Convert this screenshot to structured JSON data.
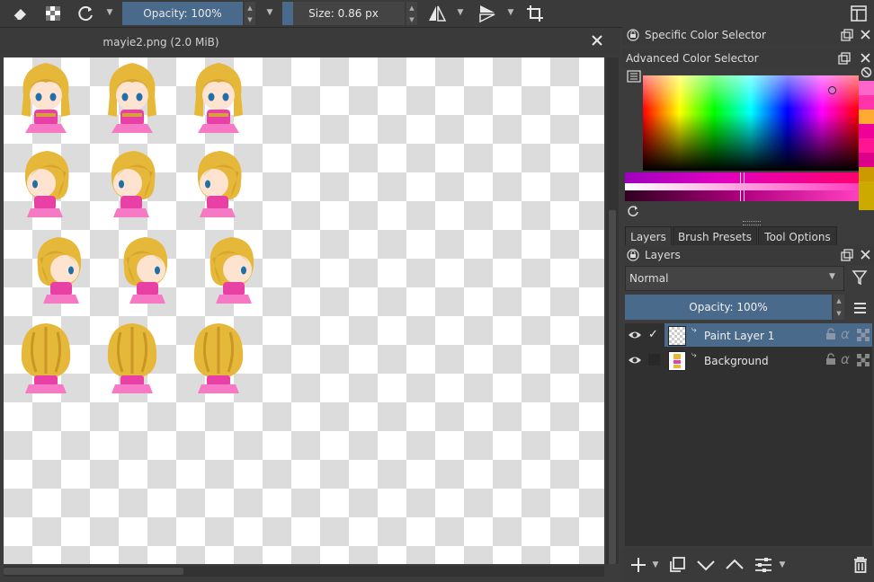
{
  "toolbar": {
    "opacity_label": "Opacity: 100%",
    "size_label": "Size: 0.86 px"
  },
  "document": {
    "title": "mayie2.png (2.0 MiB)"
  },
  "dockers": {
    "specific_color_selector": "Specific Color Selector",
    "advanced_color_selector": "Advanced Color Selector",
    "layers_title": "Layers"
  },
  "tabs": [
    {
      "label": "Layers",
      "active": true
    },
    {
      "label": "Brush Presets",
      "active": false
    },
    {
      "label": "Tool Options",
      "active": false
    }
  ],
  "layers_panel": {
    "blend_mode": "Normal",
    "opacity_label": "Opacity:  100%",
    "layers": [
      {
        "name": "Paint Layer 1",
        "visible": true,
        "checked": true,
        "selected": true
      },
      {
        "name": "Background",
        "visible": true,
        "checked": false,
        "selected": false
      }
    ]
  },
  "colors": {
    "accent": "#4a6a8c",
    "palette_swatches": [
      "#ff66cc",
      "#ff33aa",
      "#ffaa33",
      "#ee0099",
      "#ff1493",
      "#dd0088",
      "#cc9900",
      "#ccaa00"
    ]
  },
  "icons": [
    "eraser-icon",
    "alpha-lock-icon",
    "refresh-icon",
    "mirror-horizontal-icon",
    "mirror-vertical-icon",
    "crop-icon",
    "workspace-icon",
    "close-icon",
    "float-icon",
    "eye-icon",
    "lock-icon",
    "alpha-icon",
    "filter-icon",
    "menu-icon",
    "add-icon",
    "duplicate-icon",
    "move-down-icon",
    "move-up-icon",
    "properties-icon",
    "trash-icon"
  ]
}
